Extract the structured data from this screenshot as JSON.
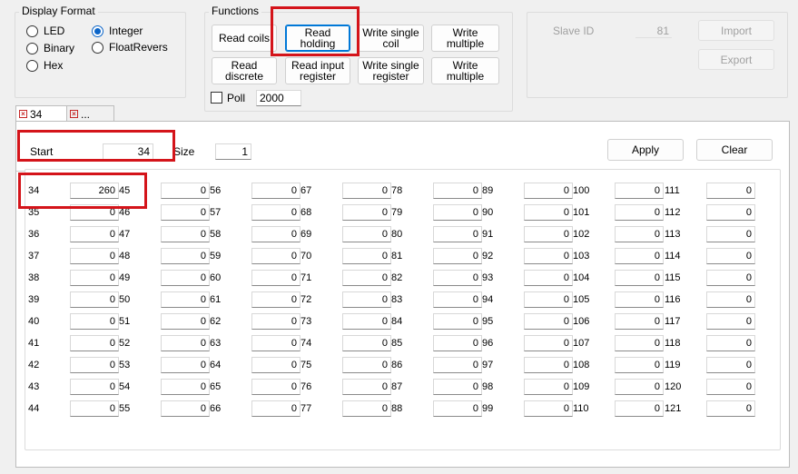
{
  "display_format": {
    "title": "Display Format",
    "options": [
      {
        "label": "LED",
        "checked": false
      },
      {
        "label": "Integer",
        "checked": true
      },
      {
        "label": "Binary",
        "checked": false
      },
      {
        "label": "FloatRevers",
        "checked": false
      },
      {
        "label": "Hex",
        "checked": false
      }
    ]
  },
  "functions": {
    "title": "Functions",
    "read_coils": "Read coils",
    "read_holding": "Read\nholding",
    "write_single_coil": "Write single\ncoil",
    "write_multiple_1": "Write\nmultiple",
    "read_discrete": "Read\ndiscrete",
    "read_input_register": "Read input\nregister",
    "write_single_register": "Write single\nregister",
    "write_multiple_2": "Write\nmultiple",
    "poll_label": "Poll",
    "poll_value": "2000"
  },
  "slave": {
    "slave_id_label": "Slave ID",
    "slave_id_value": "81",
    "import_label": "Import",
    "export_label": "Export"
  },
  "tabs": [
    {
      "label": "34"
    },
    {
      "label": "..."
    }
  ],
  "controls": {
    "start_label": "Start",
    "start_value": "34",
    "size_label": "Size",
    "size_value": "1",
    "apply_label": "Apply",
    "clear_label": "Clear"
  },
  "registers": {
    "columns": [
      {
        "addresses": [
          "34",
          "35",
          "36",
          "37",
          "38",
          "39",
          "40",
          "41",
          "42",
          "43",
          "44"
        ],
        "values": [
          "260",
          "0",
          "0",
          "0",
          "0",
          "0",
          "0",
          "0",
          "0",
          "0",
          "0"
        ]
      },
      {
        "addresses": [
          "45",
          "46",
          "47",
          "48",
          "49",
          "50",
          "51",
          "52",
          "53",
          "54",
          "55"
        ],
        "values": [
          "0",
          "0",
          "0",
          "0",
          "0",
          "0",
          "0",
          "0",
          "0",
          "0",
          "0"
        ]
      },
      {
        "addresses": [
          "56",
          "57",
          "58",
          "59",
          "60",
          "61",
          "62",
          "63",
          "64",
          "65",
          "66"
        ],
        "values": [
          "0",
          "0",
          "0",
          "0",
          "0",
          "0",
          "0",
          "0",
          "0",
          "0",
          "0"
        ]
      },
      {
        "addresses": [
          "67",
          "68",
          "69",
          "70",
          "71",
          "72",
          "73",
          "74",
          "75",
          "76",
          "77"
        ],
        "values": [
          "0",
          "0",
          "0",
          "0",
          "0",
          "0",
          "0",
          "0",
          "0",
          "0",
          "0"
        ]
      },
      {
        "addresses": [
          "78",
          "79",
          "80",
          "81",
          "82",
          "83",
          "84",
          "85",
          "86",
          "87",
          "88"
        ],
        "values": [
          "0",
          "0",
          "0",
          "0",
          "0",
          "0",
          "0",
          "0",
          "0",
          "0",
          "0"
        ]
      },
      {
        "addresses": [
          "89",
          "90",
          "91",
          "92",
          "93",
          "94",
          "95",
          "96",
          "97",
          "98",
          "99"
        ],
        "values": [
          "0",
          "0",
          "0",
          "0",
          "0",
          "0",
          "0",
          "0",
          "0",
          "0",
          "0"
        ]
      },
      {
        "addresses": [
          "100",
          "101",
          "102",
          "103",
          "104",
          "105",
          "106",
          "107",
          "108",
          "109",
          "110"
        ],
        "values": [
          "0",
          "0",
          "0",
          "0",
          "0",
          "0",
          "0",
          "0",
          "0",
          "0",
          "0"
        ]
      },
      {
        "addresses": [
          "111",
          "112",
          "113",
          "114",
          "115",
          "116",
          "117",
          "118",
          "119",
          "120",
          "121"
        ],
        "values": [
          "0",
          "0",
          "0",
          "0",
          "0",
          "0",
          "0",
          "0",
          "0",
          "0",
          "0"
        ]
      }
    ]
  },
  "colors": {
    "highlight": "#d4141a",
    "accent": "#0078d7"
  }
}
